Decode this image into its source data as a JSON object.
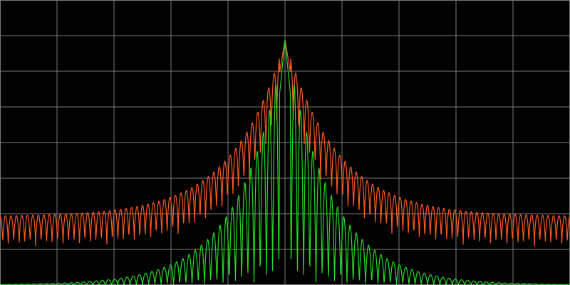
{
  "chart_data": {
    "type": "line",
    "title": "",
    "xlabel": "",
    "ylabel": "",
    "grid": true,
    "legend": "none",
    "x_range": [
      -1,
      1
    ],
    "y_range": [
      0,
      1
    ],
    "grid_divisions": {
      "x": 10,
      "y": 8
    },
    "colors": {
      "background": "#000000",
      "grid": "#7a7a7a",
      "series_1": "#ff5a1f",
      "series_2": "#22dd22"
    },
    "series": [
      {
        "color_key": "series_1",
        "peak_value": 0.86,
        "baseline_level": 0.24,
        "ripple_depth": 0.1,
        "lobe_count_per_side": 52
      },
      {
        "color_key": "series_2",
        "peak_value": 0.86,
        "baseline_level": 0.0,
        "ripple_depth": 0.0,
        "lobe_count_per_side": 46
      }
    ]
  }
}
